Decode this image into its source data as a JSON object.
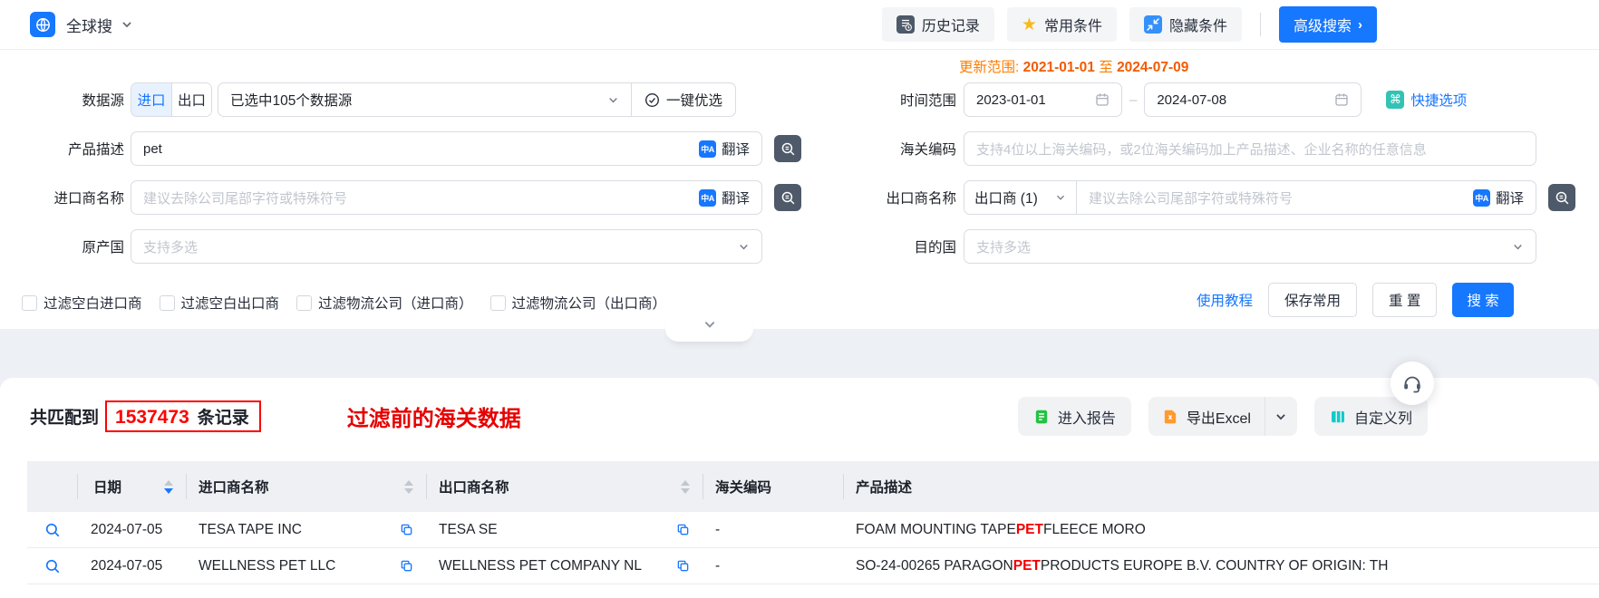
{
  "topbar": {
    "app_name": "全球搜",
    "history": "历史记录",
    "favorites": "常用条件",
    "hide_conditions": "隐藏条件",
    "advanced_search": "高级搜索"
  },
  "form": {
    "update_range": {
      "label": "更新范围:",
      "start": "2021-01-01",
      "to": "至",
      "end": "2024-07-09"
    },
    "data_source": {
      "label": "数据源",
      "import_tab": "进口",
      "export_tab": "出口",
      "selected": "已选中105个数据源",
      "optimize": "一键优选"
    },
    "time_range": {
      "label": "时间范围",
      "start": "2023-01-01",
      "end": "2024-07-08",
      "dash": "–",
      "quick_options": "快捷选项"
    },
    "product_desc": {
      "label": "产品描述",
      "value": "pet",
      "translate": "翻译"
    },
    "hs_code": {
      "label": "海关编码",
      "placeholder": "支持4位以上海关编码，或2位海关编码加上产品描述、企业名称的任意信息"
    },
    "importer_name": {
      "label": "进口商名称",
      "placeholder": "建议去除公司尾部字符或特殊符号",
      "translate": "翻译"
    },
    "exporter_name": {
      "label": "出口商名称",
      "type_selector": "出口商 (1)",
      "placeholder": "建议去除公司尾部字符或特殊符号",
      "translate": "翻译"
    },
    "origin_country": {
      "label": "原产国",
      "placeholder": "支持多选"
    },
    "dest_country": {
      "label": "目的国",
      "placeholder": "支持多选"
    },
    "filters": [
      "过滤空白进口商",
      "过滤空白出口商",
      "过滤物流公司（进口商）",
      "过滤物流公司（出口商）"
    ],
    "tutorial": "使用教程",
    "save": "保存常用",
    "reset": "重 置",
    "search": "搜 索"
  },
  "results": {
    "matched_prefix": "共匹配到",
    "count": "1537473",
    "records_suffix": "条记录",
    "annotation": "过滤前的海关数据",
    "enter_report": "进入报告",
    "export_excel": "导出Excel",
    "custom_columns": "自定义列"
  },
  "table": {
    "headers": {
      "date": "日期",
      "importer": "进口商名称",
      "exporter": "出口商名称",
      "hs_code": "海关编码",
      "product_desc": "产品描述"
    },
    "rows": [
      {
        "date": "2024-07-05",
        "importer": "TESA TAPE INC",
        "exporter": "TESA SE",
        "hs_code": "-",
        "desc_pre": "FOAM MOUNTING TAPE ",
        "keyword": "PET",
        "desc_post": " FLEECE MORO"
      },
      {
        "date": "2024-07-05",
        "importer": "WELLNESS PET LLC",
        "exporter": "WELLNESS PET COMPANY NL",
        "hs_code": "-",
        "desc_pre": "SO-24-00265 PARAGON ",
        "keyword": "PET",
        "desc_post": " PRODUCTS EUROPE B.V. COUNTRY OF ORIGIN: TH"
      }
    ]
  },
  "icons": {
    "star": "★",
    "cmd": "⌘",
    "translate_glyph": "中A"
  },
  "colors": {
    "primary": "#1677ff",
    "update_orange": "#f25b00",
    "highlight_red": "#f20000",
    "annotation_red": "#e60000",
    "quick_teal": "#33c3b5",
    "report_green": "#23c343",
    "excel_orange": "#ff9a2e",
    "columns_teal": "#14c9c9",
    "dark_icon": "#4e5969",
    "star_gold": "#f7ba1e"
  }
}
